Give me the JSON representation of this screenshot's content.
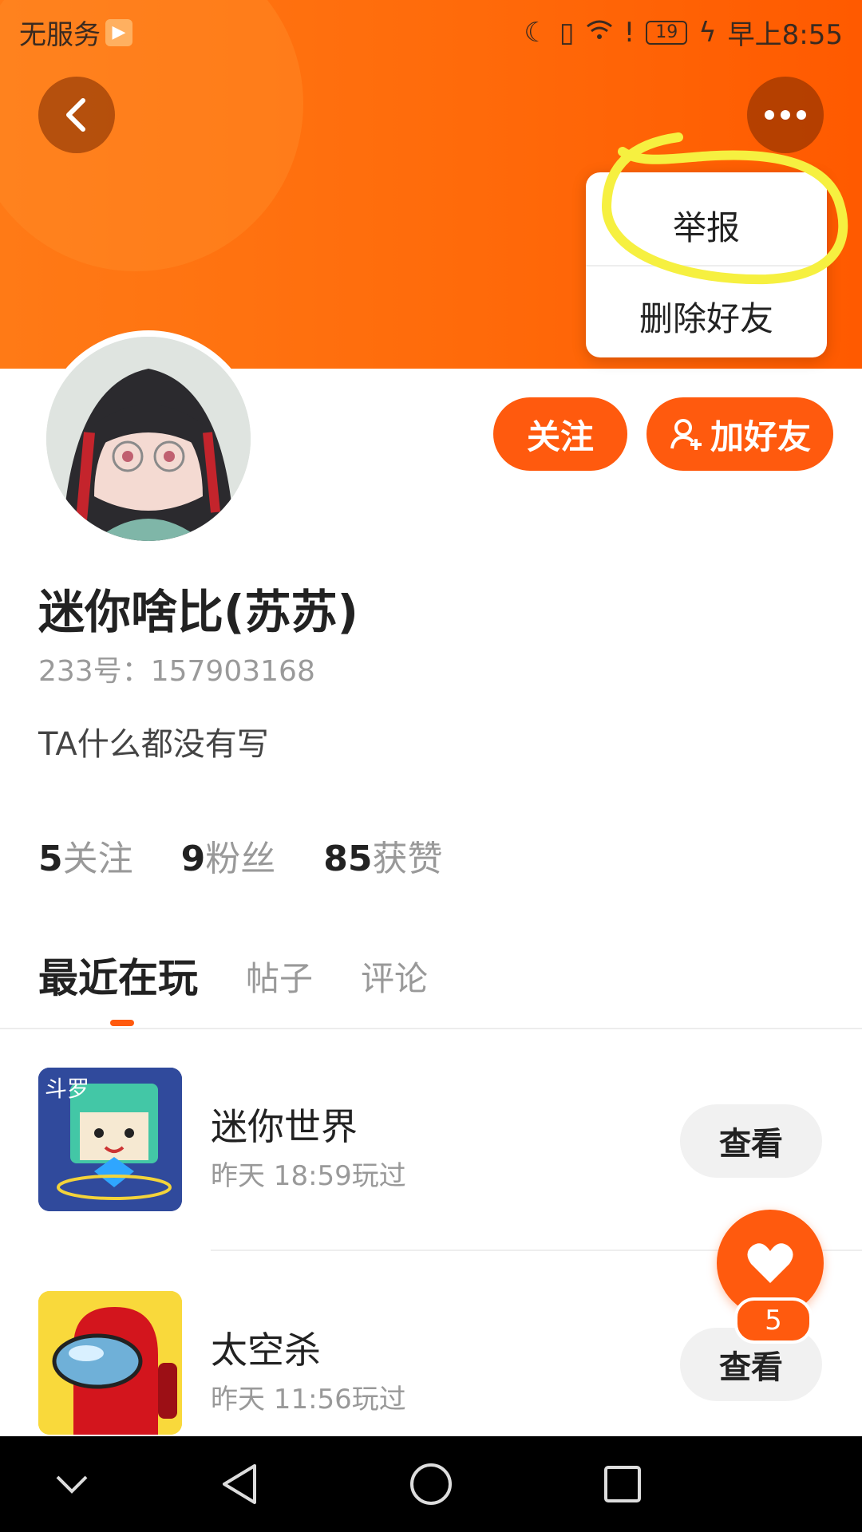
{
  "status_bar": {
    "carrier": "无服务",
    "battery": "19",
    "time": "早上8:55"
  },
  "menu": {
    "report": "举报",
    "delete_friend": "删除好友"
  },
  "actions": {
    "follow": "关注",
    "add_friend": "加好友"
  },
  "profile": {
    "name": "迷你啥比(苏苏)",
    "id_text": "233号：157903168",
    "bio": "TA什么都没有写"
  },
  "stats": [
    {
      "value": "5",
      "label": "关注"
    },
    {
      "value": "9",
      "label": "粉丝"
    },
    {
      "value": "85",
      "label": "获赞"
    }
  ],
  "tabs": {
    "recent": "最近在玩",
    "posts": "帖子",
    "comments": "评论"
  },
  "games": [
    {
      "title": "迷你世界",
      "played": "昨天 18:59玩过",
      "button": "查看",
      "icon_badge": "斗罗"
    },
    {
      "title": "太空杀",
      "played": "昨天 11:56玩过",
      "button": "查看"
    }
  ],
  "like": {
    "count": "5"
  },
  "colors": {
    "brand": "#ff5a0e",
    "header": "#ff6a0a",
    "highlight": "#f6f040"
  }
}
